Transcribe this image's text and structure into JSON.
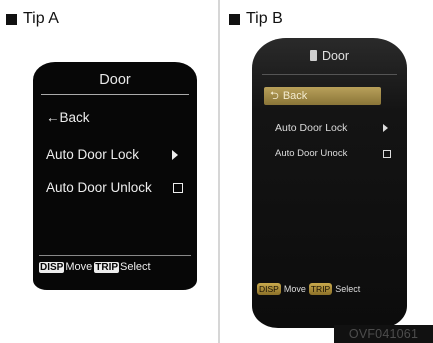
{
  "tip_a": {
    "label": "Tip A",
    "screen": {
      "title": "Door",
      "back": "←Back",
      "auto_door_lock": "Auto Door Lock",
      "auto_door_unlock": "Auto Door Unlock",
      "footer": {
        "disp_key": "DISP",
        "move_label": "Move",
        "trip_key": "TRIP",
        "select_label": "Select"
      }
    }
  },
  "tip_b": {
    "label": "Tip B",
    "screen": {
      "title": "Door",
      "back": "Back",
      "auto_door_lock": "Auto Door Lock",
      "auto_door_unlock": "Auto Door Unock",
      "footer": {
        "disp_key": "DISP",
        "move_label": "Move",
        "trip_key": "TRIP",
        "select_label": "Select"
      }
    }
  },
  "code": "OVF041061",
  "colors": {
    "screen_bg": "#070707",
    "highlight_gold": "#b8a05a",
    "key_gold": "#c9a94c"
  },
  "icons": [
    "back-arrow-icon",
    "arrow-right-icon",
    "checkbox-icon",
    "door-icon",
    "return-icon"
  ]
}
